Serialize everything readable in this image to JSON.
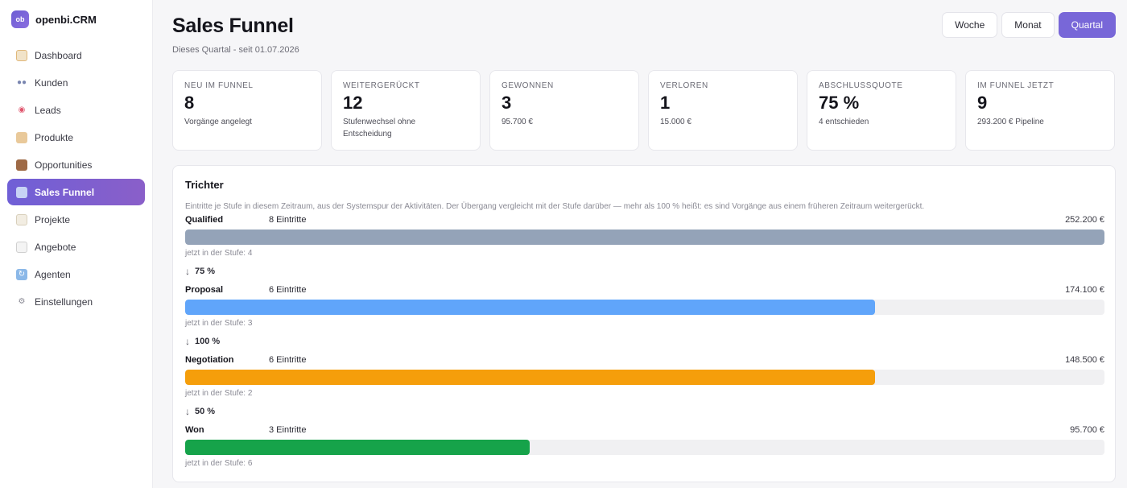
{
  "app": {
    "logo_text": "ob",
    "name": "openbi.CRM"
  },
  "sidebar": {
    "items": [
      {
        "label": "Dashboard",
        "icon": "dashboard-icon"
      },
      {
        "label": "Kunden",
        "icon": "users-icon"
      },
      {
        "label": "Leads",
        "icon": "target-icon"
      },
      {
        "label": "Produkte",
        "icon": "box-icon"
      },
      {
        "label": "Opportunities",
        "icon": "briefcase-icon"
      },
      {
        "label": "Sales Funnel",
        "icon": "chart-icon",
        "active": true
      },
      {
        "label": "Projekte",
        "icon": "clipboard-icon"
      },
      {
        "label": "Angebote",
        "icon": "document-icon"
      },
      {
        "label": "Agenten",
        "icon": "refresh-icon"
      },
      {
        "label": "Einstellungen",
        "icon": "gear-icon"
      }
    ]
  },
  "header": {
    "title": "Sales Funnel",
    "subtitle": "Dieses Quartal - seit 01.07.2026",
    "periods": [
      "Woche",
      "Monat",
      "Quartal"
    ],
    "active_period": "Quartal"
  },
  "kpis": [
    {
      "label": "Neu im Funnel",
      "value": "8",
      "note": "Vorgänge angelegt"
    },
    {
      "label": "Weitergerückt",
      "value": "12",
      "note": "Stufenwechsel ohne Entscheidung"
    },
    {
      "label": "Gewonnen",
      "value": "3",
      "note": "95.700 €"
    },
    {
      "label": "Verloren",
      "value": "1",
      "note": "15.000 €"
    },
    {
      "label": "Abschlussquote",
      "value": "75 %",
      "note": "4 entschieden"
    },
    {
      "label": "Im Funnel jetzt",
      "value": "9",
      "note": "293.200 € Pipeline"
    }
  ],
  "funnel": {
    "title": "Trichter",
    "description": "Eintritte je Stufe in diesem Zeitraum, aus der Systemspur der Aktivitäten. Der Übergang vergleicht mit der Stufe darüber — mehr als 100 % heißt: es sind Vorgänge aus einem früheren Zeitraum weitergerückt.",
    "stages": [
      {
        "name": "Qualified",
        "entries": "8 Eintritte",
        "entries_count": 8,
        "value": "252.200 €",
        "current": "jetzt in der Stufe: 4",
        "color": "#94a3b8"
      },
      {
        "name": "Proposal",
        "entries": "6 Eintritte",
        "entries_count": 6,
        "value": "174.100 €",
        "current": "jetzt in der Stufe: 3",
        "color": "#60a5fa"
      },
      {
        "name": "Negotiation",
        "entries": "6 Eintritte",
        "entries_count": 6,
        "value": "148.500 €",
        "current": "jetzt in der Stufe: 2",
        "color": "#f59e0b"
      },
      {
        "name": "Won",
        "entries": "3 Eintritte",
        "entries_count": 3,
        "value": "95.700 €",
        "current": "jetzt in der Stufe: 6",
        "color": "#16a34a"
      }
    ],
    "conversions": [
      "75 %",
      "100 %",
      "50 %"
    ]
  }
}
